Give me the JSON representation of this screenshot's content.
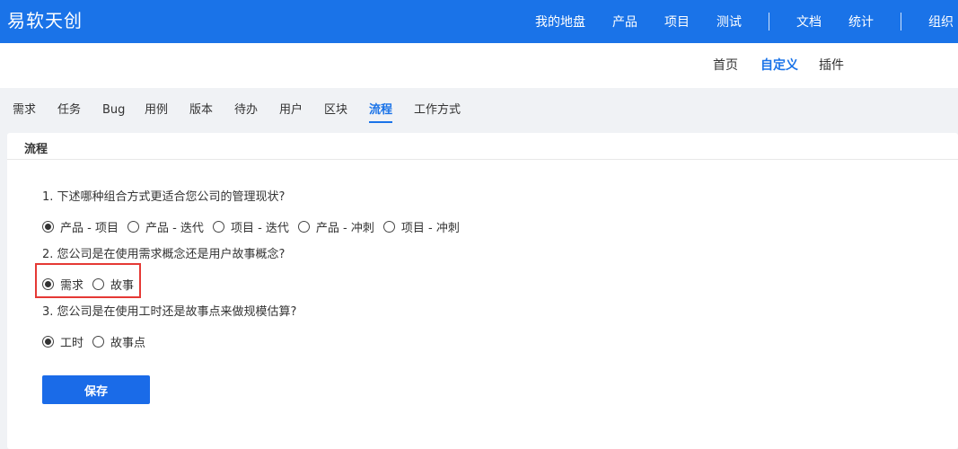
{
  "app": {
    "brand": "易软天创"
  },
  "topnav": {
    "items": [
      "我的地盘",
      "产品",
      "项目",
      "测试",
      "文档",
      "统计",
      "组织"
    ]
  },
  "subnav": {
    "items": [
      "首页",
      "自定义",
      "插件"
    ],
    "active": "自定义"
  },
  "tabs": {
    "items": [
      "需求",
      "任务",
      "Bug",
      "用例",
      "版本",
      "待办",
      "用户",
      "区块",
      "流程",
      "工作方式"
    ],
    "active": "流程"
  },
  "panel": {
    "title": "流程",
    "questions": [
      {
        "text": "1. 下述哪种组合方式更适合您公司的管理现状?",
        "options": [
          "产品 - 项目",
          "产品 - 迭代",
          "项目 - 迭代",
          "产品 - 冲刺",
          "项目 - 冲刺"
        ],
        "selected": 0
      },
      {
        "text": "2. 您公司是在使用需求概念还是用户故事概念?",
        "options": [
          "需求",
          "故事"
        ],
        "selected": 0
      },
      {
        "text": "3. 您公司是在使用工时还是故事点来做规模估算?",
        "options": [
          "工时",
          "故事点"
        ],
        "selected": 0
      }
    ],
    "save_label": "保存"
  },
  "colors": {
    "primary": "#1a73e8",
    "highlight": "#e53935"
  }
}
